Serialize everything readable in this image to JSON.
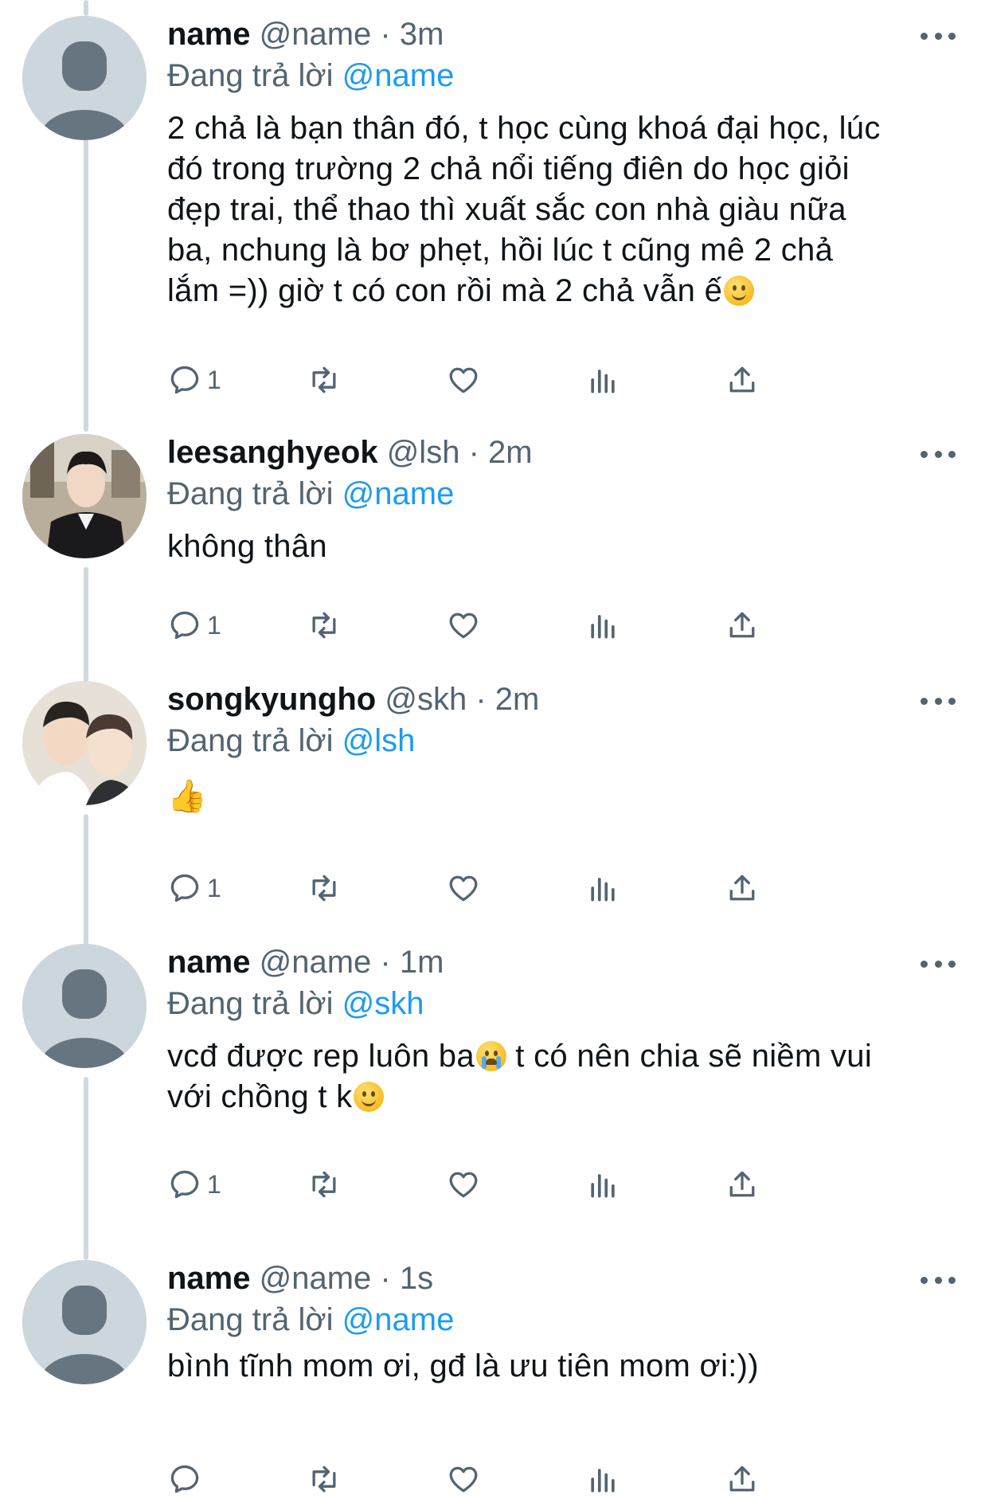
{
  "colors": {
    "accent": "#1d9bf0",
    "muted": "#536471",
    "text": "#0f1419",
    "thread": "#cfd9de"
  },
  "tweets": [
    {
      "name": "name",
      "handle": "@name",
      "time": "3m",
      "reply_prefix": "Đang trả lời",
      "reply_to": "@name",
      "text": "2 chả là bạn thân đó, t học cùng khoá đại học, lúc\nđó trong trường 2 chả nổi tiếng điên do học giỏi\nđẹp trai, thể thao thì xuất sắc con nhà giàu nữa\nba, nchung là bơ phẹt, hồi lúc t cũng mê 2 chả\nlắm =)) giờ t có con rồi mà 2 chả vẫn ế",
      "emoji": "slightly-smiling-face",
      "avatar": "default-avatar",
      "reply_count": "1"
    },
    {
      "name": "leesanghyeok",
      "handle": "@lsh",
      "time": "2m",
      "reply_prefix": "Đang trả lời",
      "reply_to": "@name",
      "text": "không thân",
      "avatar": "photo-avatar-suit",
      "reply_count": "1"
    },
    {
      "name": "songkyungho",
      "handle": "@skh",
      "time": "2m",
      "reply_prefix": "Đang trả lời",
      "reply_to": "@lsh",
      "text": "👍",
      "avatar": "photo-avatar-selfie",
      "reply_count": "1"
    },
    {
      "name": "name",
      "handle": "@name",
      "time": "1m",
      "reply_prefix": "Đang trả lời",
      "reply_to": "@skh",
      "text_part1": "vcđ được rep luôn ba",
      "text_part2": "  t có nên chia sẽ niềm vui\nvới chồng t k",
      "emoji1": "crying-face",
      "emoji2": "slightly-smiling-face",
      "avatar": "default-avatar",
      "reply_count": "1"
    },
    {
      "name": "name",
      "handle": "@name",
      "time": "1s",
      "reply_prefix": "Đang trả lời",
      "reply_to": "@name",
      "text": "bình tĩnh mom ơi, gđ là ưu tiên mom ơi:))",
      "avatar": "default-avatar",
      "reply_count": ""
    }
  ],
  "separator": "·",
  "actions": [
    "reply-icon",
    "retweet-icon",
    "like-icon",
    "views-icon",
    "share-icon"
  ]
}
